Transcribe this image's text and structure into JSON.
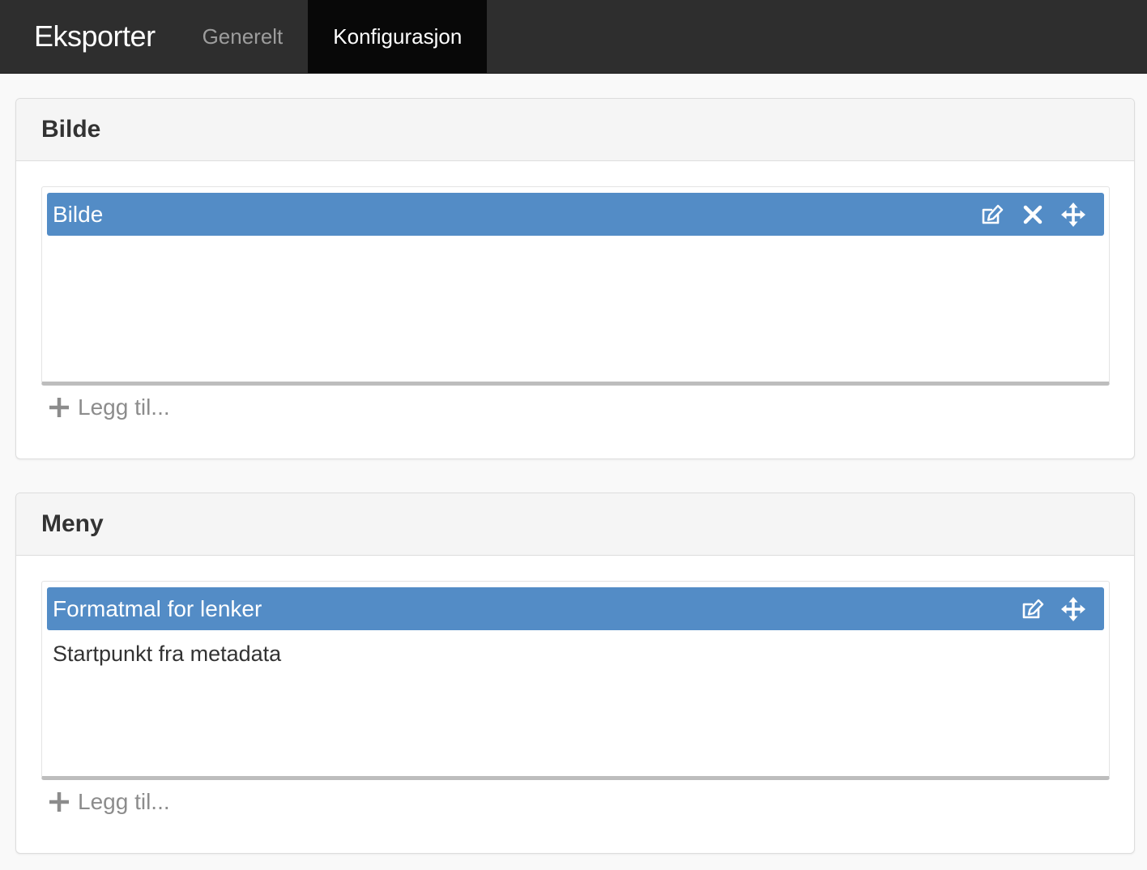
{
  "navbar": {
    "brand": "Eksporter",
    "tabs": [
      {
        "label": "Generelt",
        "active": false
      },
      {
        "label": "Konfigurasjon",
        "active": true
      }
    ]
  },
  "panels": [
    {
      "heading": "Bilde",
      "items": [
        {
          "title": "Bilde",
          "content": "",
          "actions": [
            "edit-icon",
            "close-icon",
            "move-icon"
          ]
        }
      ],
      "add_label": "Legg til..."
    },
    {
      "heading": "Meny",
      "items": [
        {
          "title": "Formatmal for lenker",
          "content": "Startpunkt fra metadata",
          "actions": [
            "edit-icon",
            "move-icon"
          ]
        }
      ],
      "add_label": "Legg til..."
    }
  ],
  "colors": {
    "navbar_bg": "#2e2e2e",
    "active_tab_bg": "#080808",
    "item_header_bg": "#538cc6",
    "muted_text": "#8c8c8c"
  }
}
